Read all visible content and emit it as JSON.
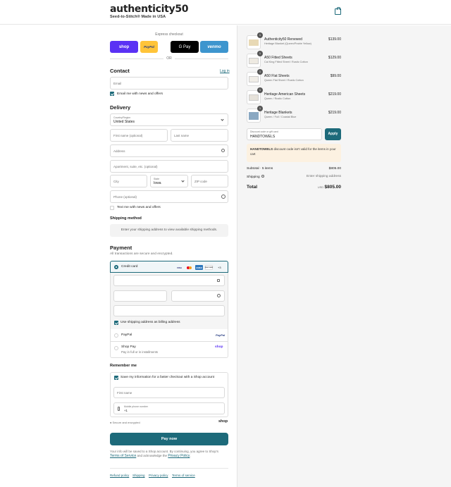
{
  "brand": {
    "name": "authenticity50",
    "tagline": "Seed-to-Stitch® Made in USA"
  },
  "express": {
    "title": "Express checkout",
    "buttons": [
      {
        "label": "shop",
        "color": "#5a31f4"
      },
      {
        "label": "PayPal",
        "color": "#ffc439"
      },
      {
        "label": "G Pay",
        "color": "#000000"
      },
      {
        "label": "venmo",
        "color": "#3d95ce"
      }
    ],
    "or": "OR"
  },
  "contact": {
    "heading": "Contact",
    "login": "Log in",
    "email_placeholder": "Email",
    "email_news": "Email me with news and offers"
  },
  "delivery": {
    "heading": "Delivery",
    "country_label": "Country/Region",
    "country_value": "United States",
    "first_name": "First name (optional)",
    "last_name": "Last name",
    "address": "Address",
    "apartment": "Apartment, suite, etc. (optional)",
    "city": "City",
    "state_label": "State",
    "state_value": "Iowa",
    "zip": "ZIP code",
    "phone": "Phone (optional)",
    "text_news": "Text me with news and offers"
  },
  "shipping_method": {
    "heading": "Shipping method",
    "message": "Enter your shipping address to view available shipping methods."
  },
  "payment": {
    "heading": "Payment",
    "subtitle": "All transactions are secure and encrypted.",
    "credit_card": "Credit card",
    "cards": [
      "VISA",
      "MC",
      "AMEX",
      "DISCOVER"
    ],
    "more_cards": "+3",
    "billing_same": "Use shipping address as billing address",
    "paypal": "PayPal",
    "paypal_logo": "PayPal",
    "shop_pay": "Shop Pay",
    "shop_pay_sub": "Pay in full or in installments",
    "shop_logo": "shop"
  },
  "remember": {
    "heading": "Remember me",
    "save_info": "Save my information for a faster checkout with a Shop account",
    "first_name": "First name",
    "mobile_label": "Mobile phone number",
    "mobile_value": "+1",
    "secure": "Secure and encrypted",
    "shop_logo": "shop"
  },
  "pay_now": "Pay now",
  "legal": {
    "text_before": "Your info will be saved to a Shop account. By continuing, you agree to Shop's",
    "terms": "Terms of Service",
    "text_mid": "and acknowledge the",
    "privacy": "Privacy Policy",
    "text_end": "."
  },
  "footer": [
    "Refund policy",
    "Shipping",
    "Privacy policy",
    "Terms of service"
  ],
  "cart": {
    "items": [
      {
        "qty": "1",
        "name": "Authenticity50 Renewed",
        "variant": "Heritage Blanket (Queen/Prairie Yellow)",
        "price": "$139.00",
        "thumb": "#e8d9b5"
      },
      {
        "qty": "1",
        "name": "A50 Fitted Sheets",
        "variant": "Cal King Fitted Sheet / Rustic Cotton",
        "price": "$129.00",
        "thumb": "#eeeae2"
      },
      {
        "qty": "1",
        "name": "A50 Flat Sheets",
        "variant": "Queen Flat Sheet / Rustic Cotton",
        "price": "$99.00",
        "thumb": "#f1eee8"
      },
      {
        "qty": "1",
        "name": "Heritage American Sheets",
        "variant": "Queen / Rustic Cotton",
        "price": "$219.00",
        "thumb": "#e6e2da"
      },
      {
        "qty": "1",
        "name": "Heritage Blankets",
        "variant": "Queen / Full / Coastal Blue",
        "price": "$219.00",
        "thumb": "#8aa8c2"
      }
    ],
    "discount_label": "Discount code or gift card",
    "discount_value": "HANDTOWELS",
    "apply": "Apply",
    "warning_code": "HANDTOWELS",
    "warning_text": "discount code isn't valid for the items in your cart",
    "subtotal_label": "Subtotal · 5 items",
    "subtotal_value": "$805.00",
    "shipping_label": "Shipping",
    "shipping_value": "Enter shipping address",
    "total_label": "Total",
    "currency": "USD",
    "total_value": "$805.00"
  }
}
